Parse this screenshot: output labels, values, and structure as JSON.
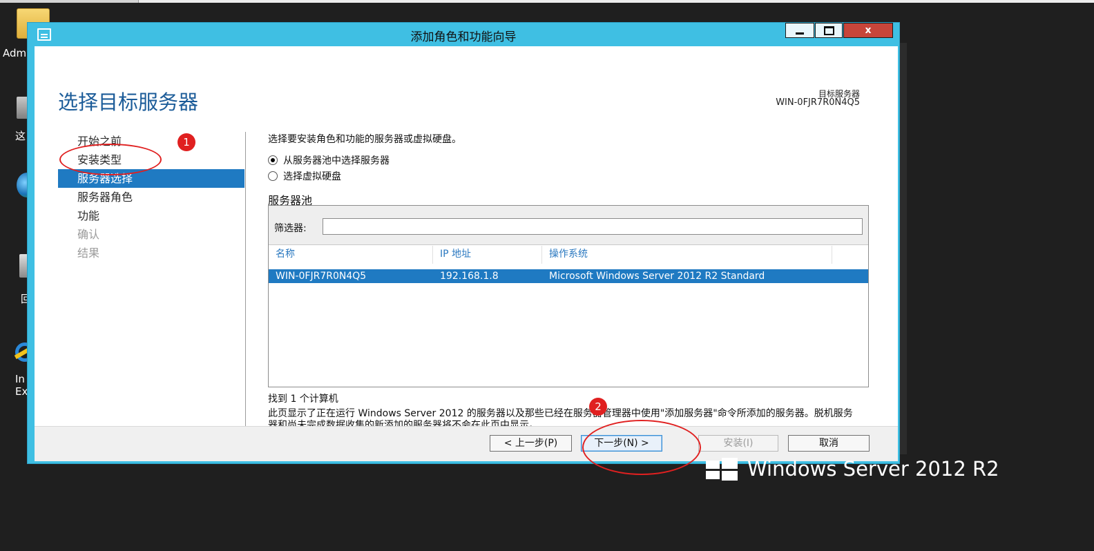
{
  "desktop": {
    "icons": [
      {
        "name": "folder-icon",
        "label": "Adm"
      },
      {
        "name": "computer-icon",
        "label": "这"
      },
      {
        "name": "network-globe-icon",
        "label": ""
      },
      {
        "name": "recycle-bin-icon",
        "label": "回"
      },
      {
        "name": "internet-explorer-icon",
        "label": "In\nEx"
      }
    ],
    "brand": "Windows Server 2012 R2"
  },
  "window": {
    "title": "添加角色和功能向导",
    "controls": {
      "minimize": "minimize",
      "maximize": "maximize",
      "close": "x"
    }
  },
  "page": {
    "title": "选择目标服务器",
    "destination_label": "目标服务器",
    "destination_value": "WIN-0FJR7R0N4Q5"
  },
  "nav": {
    "items": [
      {
        "label": "开始之前",
        "state": "normal"
      },
      {
        "label": "安装类型",
        "state": "normal"
      },
      {
        "label": "服务器选择",
        "state": "active"
      },
      {
        "label": "服务器角色",
        "state": "normal"
      },
      {
        "label": "功能",
        "state": "normal"
      },
      {
        "label": "确认",
        "state": "disabled"
      },
      {
        "label": "结果",
        "state": "disabled"
      }
    ]
  },
  "content": {
    "description": "选择要安装角色和功能的服务器或虚拟硬盘。",
    "options": [
      {
        "label": "从服务器池中选择服务器",
        "checked": true
      },
      {
        "label": "选择虚拟硬盘",
        "checked": false
      }
    ],
    "pool_label": "服务器池",
    "filter_label": "筛选器:",
    "filter_value": "",
    "columns": [
      "名称",
      "IP 地址",
      "操作系统"
    ],
    "rows": [
      {
        "name": "WIN-0FJR7R0N4Q5",
        "ip": "192.168.1.8",
        "os": "Microsoft Windows Server 2012 R2 Standard",
        "selected": true
      }
    ],
    "found": "找到 1 个计算机",
    "note": "此页显示了正在运行 Windows Server 2012 的服务器以及那些已经在服务器管理器中使用\"添加服务器\"命令所添加的服务器。脱机服务器和尚未完成数据收集的新添加的服务器将不会在此页中显示。"
  },
  "footer": {
    "prev": "< 上一步(P)",
    "next": "下一步(N) >",
    "install": "安装(I)",
    "cancel": "取消"
  },
  "annotations": {
    "badge1": "1",
    "badge2": "2",
    "color": "#e02020"
  },
  "colors": {
    "titlebar": "#3fbfe3",
    "selection": "#1f7ac2",
    "page_title": "#1c5c99",
    "close_button": "#c7453a"
  }
}
